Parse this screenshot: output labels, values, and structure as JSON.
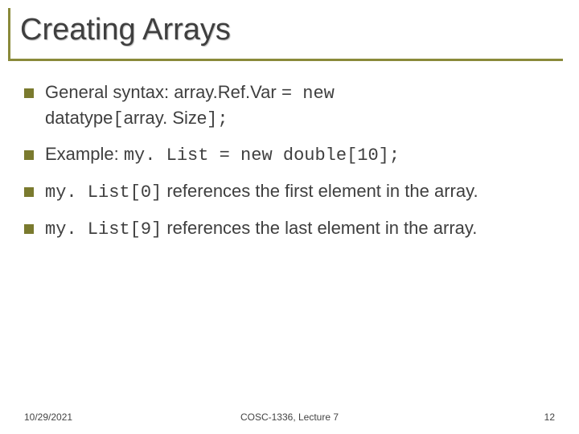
{
  "title": "Creating Arrays",
  "bullets": [
    {
      "pre": "General syntax: array.Ref.Var ",
      "mono1": "= new",
      "mid": " datatype",
      "mono2": "[",
      "mid2": "array. Size",
      "mono3": "];"
    },
    {
      "pre": "Example: ",
      "mono1": "my. List = new double[10];"
    },
    {
      "mono1": "my. List[0]",
      "post": " references the first element in the array."
    },
    {
      "mono1": "my. List[9]",
      "post": " references the last element in the array."
    }
  ],
  "footer": {
    "date": "10/29/2021",
    "center": "COSC-1336, Lecture 7",
    "page": "12"
  }
}
